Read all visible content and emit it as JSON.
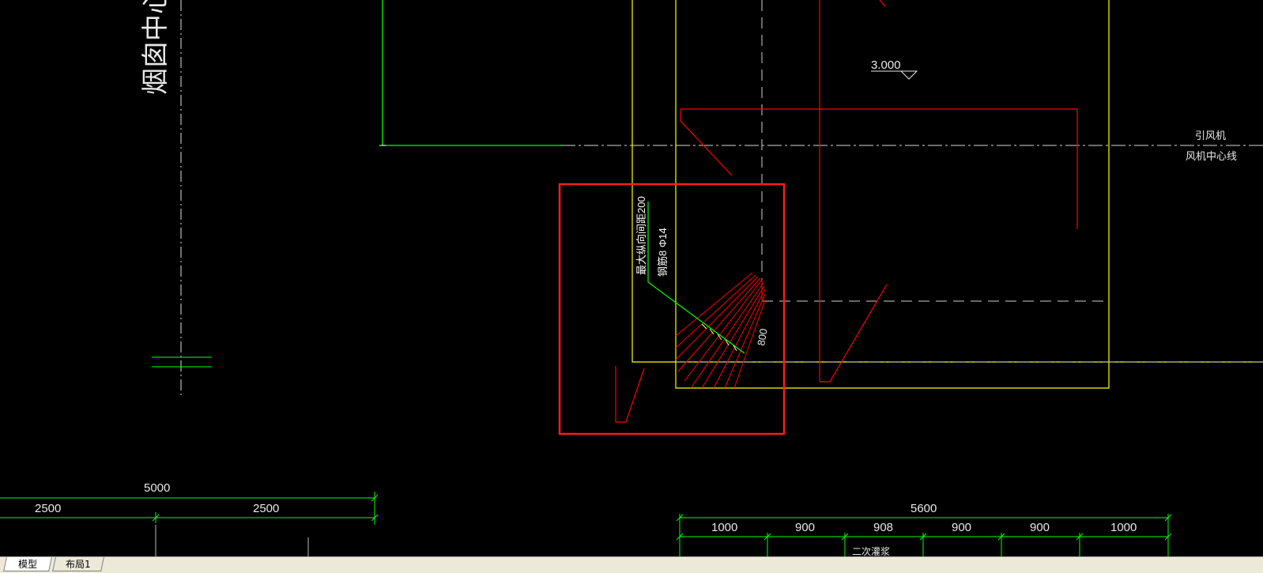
{
  "tabs": {
    "model": "模型",
    "layout1": "布局1"
  },
  "labels": {
    "chimney_centerline": "烟囱中心线",
    "fan_name": "引风机",
    "fan_centerline": "风机中心线",
    "elevation": "3.000",
    "rebar_spacing_note": "最大纵向间距200",
    "rebar_spec_note": "钢筋8 Φ14",
    "slope_dim": "800"
  },
  "dimensions": {
    "left_total": "5000",
    "left_segments": [
      "2500",
      "2500"
    ],
    "right_total": "5600",
    "right_segments": [
      "1000",
      "900",
      "908",
      "900",
      "900",
      "1000"
    ],
    "right_sub_partial": "二次灌浆"
  },
  "colors": {
    "background": "#000000",
    "yellow": "#ffff00",
    "red": "#ff0000",
    "green": "#00ff00",
    "white": "#ffffff",
    "highlight_box": "#ff1a1a"
  }
}
